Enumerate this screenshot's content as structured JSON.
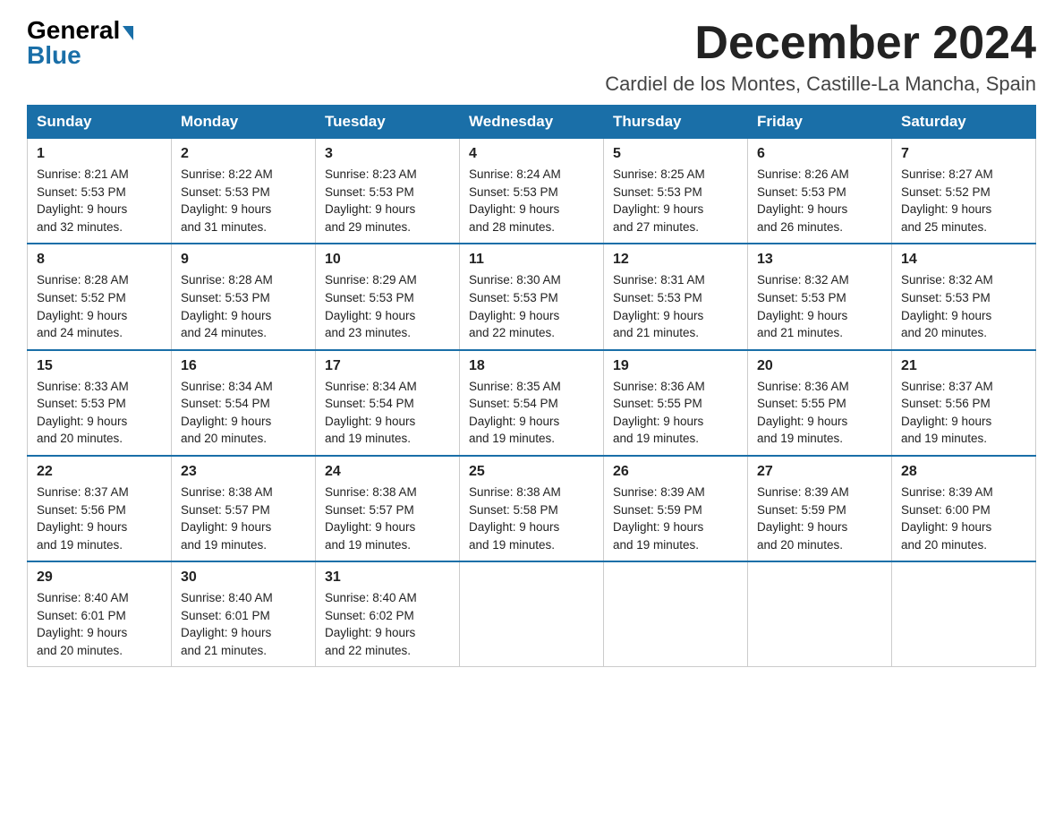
{
  "logo": {
    "general": "General",
    "blue": "Blue",
    "arrow": "▶"
  },
  "title": "December 2024",
  "location": "Cardiel de los Montes, Castille-La Mancha, Spain",
  "days_of_week": [
    "Sunday",
    "Monday",
    "Tuesday",
    "Wednesday",
    "Thursday",
    "Friday",
    "Saturday"
  ],
  "weeks": [
    [
      {
        "day": "1",
        "sunrise": "8:21 AM",
        "sunset": "5:53 PM",
        "daylight": "9 hours and 32 minutes."
      },
      {
        "day": "2",
        "sunrise": "8:22 AM",
        "sunset": "5:53 PM",
        "daylight": "9 hours and 31 minutes."
      },
      {
        "day": "3",
        "sunrise": "8:23 AM",
        "sunset": "5:53 PM",
        "daylight": "9 hours and 29 minutes."
      },
      {
        "day": "4",
        "sunrise": "8:24 AM",
        "sunset": "5:53 PM",
        "daylight": "9 hours and 28 minutes."
      },
      {
        "day": "5",
        "sunrise": "8:25 AM",
        "sunset": "5:53 PM",
        "daylight": "9 hours and 27 minutes."
      },
      {
        "day": "6",
        "sunrise": "8:26 AM",
        "sunset": "5:53 PM",
        "daylight": "9 hours and 26 minutes."
      },
      {
        "day": "7",
        "sunrise": "8:27 AM",
        "sunset": "5:52 PM",
        "daylight": "9 hours and 25 minutes."
      }
    ],
    [
      {
        "day": "8",
        "sunrise": "8:28 AM",
        "sunset": "5:52 PM",
        "daylight": "9 hours and 24 minutes."
      },
      {
        "day": "9",
        "sunrise": "8:28 AM",
        "sunset": "5:53 PM",
        "daylight": "9 hours and 24 minutes."
      },
      {
        "day": "10",
        "sunrise": "8:29 AM",
        "sunset": "5:53 PM",
        "daylight": "9 hours and 23 minutes."
      },
      {
        "day": "11",
        "sunrise": "8:30 AM",
        "sunset": "5:53 PM",
        "daylight": "9 hours and 22 minutes."
      },
      {
        "day": "12",
        "sunrise": "8:31 AM",
        "sunset": "5:53 PM",
        "daylight": "9 hours and 21 minutes."
      },
      {
        "day": "13",
        "sunrise": "8:32 AM",
        "sunset": "5:53 PM",
        "daylight": "9 hours and 21 minutes."
      },
      {
        "day": "14",
        "sunrise": "8:32 AM",
        "sunset": "5:53 PM",
        "daylight": "9 hours and 20 minutes."
      }
    ],
    [
      {
        "day": "15",
        "sunrise": "8:33 AM",
        "sunset": "5:53 PM",
        "daylight": "9 hours and 20 minutes."
      },
      {
        "day": "16",
        "sunrise": "8:34 AM",
        "sunset": "5:54 PM",
        "daylight": "9 hours and 20 minutes."
      },
      {
        "day": "17",
        "sunrise": "8:34 AM",
        "sunset": "5:54 PM",
        "daylight": "9 hours and 19 minutes."
      },
      {
        "day": "18",
        "sunrise": "8:35 AM",
        "sunset": "5:54 PM",
        "daylight": "9 hours and 19 minutes."
      },
      {
        "day": "19",
        "sunrise": "8:36 AM",
        "sunset": "5:55 PM",
        "daylight": "9 hours and 19 minutes."
      },
      {
        "day": "20",
        "sunrise": "8:36 AM",
        "sunset": "5:55 PM",
        "daylight": "9 hours and 19 minutes."
      },
      {
        "day": "21",
        "sunrise": "8:37 AM",
        "sunset": "5:56 PM",
        "daylight": "9 hours and 19 minutes."
      }
    ],
    [
      {
        "day": "22",
        "sunrise": "8:37 AM",
        "sunset": "5:56 PM",
        "daylight": "9 hours and 19 minutes."
      },
      {
        "day": "23",
        "sunrise": "8:38 AM",
        "sunset": "5:57 PM",
        "daylight": "9 hours and 19 minutes."
      },
      {
        "day": "24",
        "sunrise": "8:38 AM",
        "sunset": "5:57 PM",
        "daylight": "9 hours and 19 minutes."
      },
      {
        "day": "25",
        "sunrise": "8:38 AM",
        "sunset": "5:58 PM",
        "daylight": "9 hours and 19 minutes."
      },
      {
        "day": "26",
        "sunrise": "8:39 AM",
        "sunset": "5:59 PM",
        "daylight": "9 hours and 19 minutes."
      },
      {
        "day": "27",
        "sunrise": "8:39 AM",
        "sunset": "5:59 PM",
        "daylight": "9 hours and 20 minutes."
      },
      {
        "day": "28",
        "sunrise": "8:39 AM",
        "sunset": "6:00 PM",
        "daylight": "9 hours and 20 minutes."
      }
    ],
    [
      {
        "day": "29",
        "sunrise": "8:40 AM",
        "sunset": "6:01 PM",
        "daylight": "9 hours and 20 minutes."
      },
      {
        "day": "30",
        "sunrise": "8:40 AM",
        "sunset": "6:01 PM",
        "daylight": "9 hours and 21 minutes."
      },
      {
        "day": "31",
        "sunrise": "8:40 AM",
        "sunset": "6:02 PM",
        "daylight": "9 hours and 22 minutes."
      },
      null,
      null,
      null,
      null
    ]
  ],
  "labels": {
    "sunrise": "Sunrise:",
    "sunset": "Sunset:",
    "daylight": "Daylight:"
  }
}
